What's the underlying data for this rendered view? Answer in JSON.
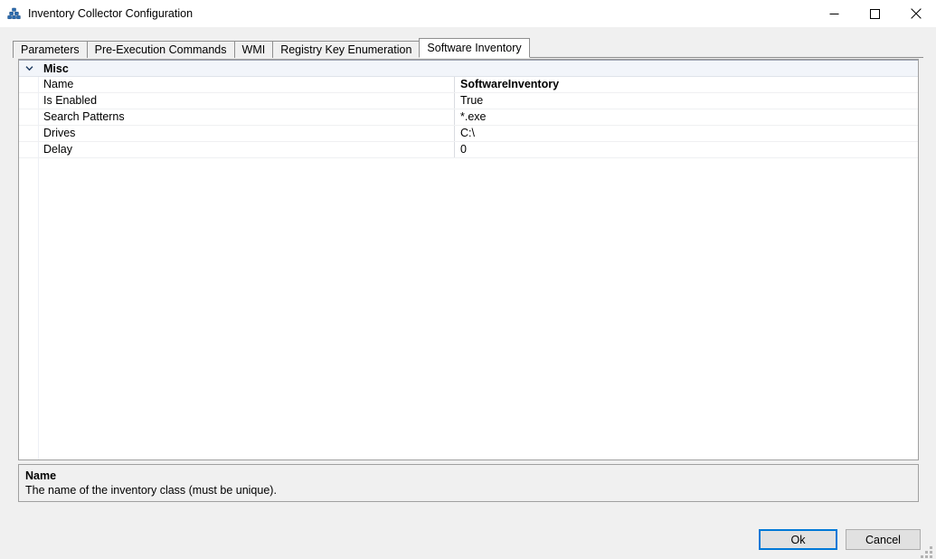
{
  "window": {
    "title": "Inventory Collector Configuration",
    "icon": "blocks-icon",
    "controls": {
      "minimize": "—",
      "maximize": "☐",
      "close": "✕"
    }
  },
  "tabs": [
    {
      "label": "Parameters",
      "selected": false
    },
    {
      "label": "Pre-Execution Commands",
      "selected": false
    },
    {
      "label": "WMI",
      "selected": false
    },
    {
      "label": "Registry Key Enumeration",
      "selected": false
    },
    {
      "label": "Software Inventory",
      "selected": true
    }
  ],
  "property_grid": {
    "category": {
      "label": "Misc",
      "expander_icon": "chevron-down-icon",
      "expanded": true
    },
    "rows": [
      {
        "name": "Name",
        "value": "SoftwareInventory",
        "bold": true
      },
      {
        "name": "Is Enabled",
        "value": "True",
        "bold": false
      },
      {
        "name": "Search Patterns",
        "value": "*.exe",
        "bold": false
      },
      {
        "name": "Drives",
        "value": "C:\\",
        "bold": false
      },
      {
        "name": "Delay",
        "value": "0",
        "bold": false
      }
    ]
  },
  "description": {
    "title": "Name",
    "text": "The name of the inventory class (must be unique)."
  },
  "footer": {
    "ok_label": "Ok",
    "cancel_label": "Cancel"
  },
  "colors": {
    "accent": "#0078d7",
    "window_bg": "#f0f0f0",
    "grid_bg": "#ffffff",
    "category_bg": "#f2f5fa",
    "close_hover": "#e81123"
  }
}
